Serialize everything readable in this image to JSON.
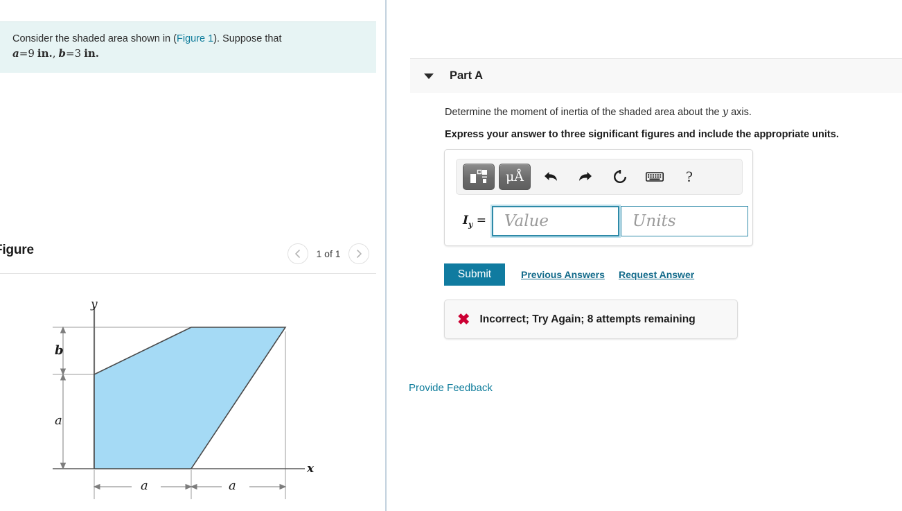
{
  "problem": {
    "text_before_link": "Consider the shaded area shown in (",
    "figure_link": "Figure 1",
    "text_after_link": "). Suppose that",
    "given_a_var": "a",
    "given_a_eq": "=",
    "given_a_value": "9",
    "given_a_unit": "in.",
    "given_separator": ",",
    "given_b_var": "b",
    "given_b_eq": "=",
    "given_b_value": "3",
    "given_b_unit": "in."
  },
  "figure_panel": {
    "title": "Figure",
    "counter": "1 of 1",
    "prev_icon": "chevron-left-icon",
    "next_icon": "chevron-right-icon"
  },
  "figure_diagram": {
    "y_axis_label": "y",
    "x_axis_label": "x",
    "vertical_dim_top": "b",
    "vertical_dim_bottom": "a",
    "horizontal_dim_left": "a",
    "horizontal_dim_right": "a",
    "fill_color": "#a5daf5",
    "outline_color": "#4a4a4a",
    "dimension_line_color": "#8c8c8c"
  },
  "part": {
    "caret_icon": "caret-down-icon",
    "label": "Part A",
    "question": "Determine the moment of inertia of the shaded area about the ",
    "question_var": "y",
    "question_tail": " axis.",
    "instruction": "Express your answer to three significant figures and include the appropriate units."
  },
  "toolbar": {
    "template_button_icon": "math-template-icon",
    "units_button_label": "μÅ",
    "units_button_icon": "micro-angstrom-icon",
    "undo_icon": "undo-arrow-icon",
    "redo_icon": "redo-arrow-icon",
    "reset_icon": "reset-circular-arrow-icon",
    "keyboard_icon": "keyboard-icon",
    "help_label": "?",
    "help_icon": "question-mark-icon"
  },
  "answer": {
    "quantity_symbol": "I",
    "quantity_subscript": "y",
    "equals": "=",
    "value_placeholder": "Value",
    "units_placeholder": "Units",
    "value_current": "",
    "units_current": ""
  },
  "actions": {
    "submit_label": "Submit",
    "previous_answers_label": "Previous Answers",
    "request_answer_label": "Request Answer"
  },
  "feedback": {
    "status_icon": "x-mark-icon",
    "status_glyph": "✖",
    "message": "Incorrect; Try Again; 8 attempts remaining"
  },
  "footer": {
    "provide_feedback_label": "Provide Feedback"
  },
  "colors": {
    "submit_blue": "#107ba0",
    "link_teal": "#0e7c9b",
    "problem_bg": "#e7f4f4",
    "error_red": "#cc0033",
    "shape_fill": "#a5daf5",
    "input_focus": "#2e8aa8"
  }
}
